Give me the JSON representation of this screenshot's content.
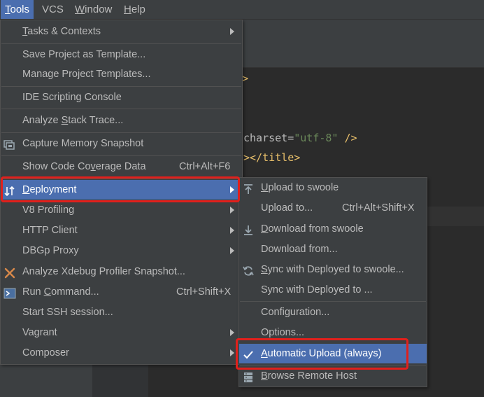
{
  "menubar": {
    "items": [
      {
        "label": "Tools",
        "mn": "T",
        "rest": "ools",
        "active": true
      },
      {
        "label": "VCS",
        "mn": "",
        "rest": "VCS",
        "active": false
      },
      {
        "label": "Window",
        "mn": "W",
        "rest": "indow",
        "active": false
      },
      {
        "label": "Help",
        "mn": "H",
        "rest": "elp",
        "active": false
      }
    ]
  },
  "code": {
    "line1": ">",
    "line2a": "charset=",
    "line2b": "\"utf-8\"",
    "line2c": " />",
    "line3a": ">",
    "line3b": "</title>",
    "line3c": ">"
  },
  "tools_menu": {
    "tasks": {
      "pre": "",
      "mn": "T",
      "post": "asks & Contexts"
    },
    "save_template": "Save Project as Template...",
    "manage_templates": "Manage Project Templates...",
    "ide_console": "IDE Scripting Console",
    "analyze_stack": {
      "pre": "Analyze ",
      "mn": "S",
      "post": "tack Trace..."
    },
    "capture_memory": "Capture Memory Snapshot",
    "coverage": {
      "pre": "Show Code Co",
      "mn": "v",
      "post": "erage Data",
      "shortcut": "Ctrl+Alt+F6"
    },
    "deployment": {
      "pre": "",
      "mn": "D",
      "post": "eployment"
    },
    "v8": "V8 Profiling",
    "http": "HTTP Client",
    "dbgp": "DBGp Proxy",
    "xdebug": "Analyze Xdebug Profiler Snapshot...",
    "run_command": {
      "pre": "Run ",
      "mn": "C",
      "post": "ommand...",
      "shortcut": "Ctrl+Shift+X"
    },
    "ssh": "Start SSH session...",
    "vagrant": "Vagrant",
    "composer": "Composer"
  },
  "deployment_menu": {
    "upload_to_swoole": {
      "pre": "",
      "mn": "U",
      "post": "pload to swoole"
    },
    "upload_to": {
      "label": "Upload to...",
      "shortcut": "Ctrl+Alt+Shift+X"
    },
    "download_from_swoole": {
      "pre": "",
      "mn": "D",
      "post": "ownload from swoole"
    },
    "download_from": "Download from...",
    "sync_swoole": {
      "pre": "",
      "mn": "S",
      "post": "ync with Deployed to swoole..."
    },
    "sync_to": "Sync with Deployed to ...",
    "configuration": "Configuration...",
    "options": "Options...",
    "auto_upload": {
      "pre": "",
      "mn": "A",
      "post": "utomatic Upload (always)",
      "checked": true
    },
    "browse": {
      "pre": "",
      "mn": "B",
      "post": "rowse Remote Host"
    }
  },
  "colors": {
    "menu_bg": "#3c3f41",
    "selection": "#4b6eaf",
    "highlight_box": "#e0201c",
    "text": "#bbbbbb"
  }
}
